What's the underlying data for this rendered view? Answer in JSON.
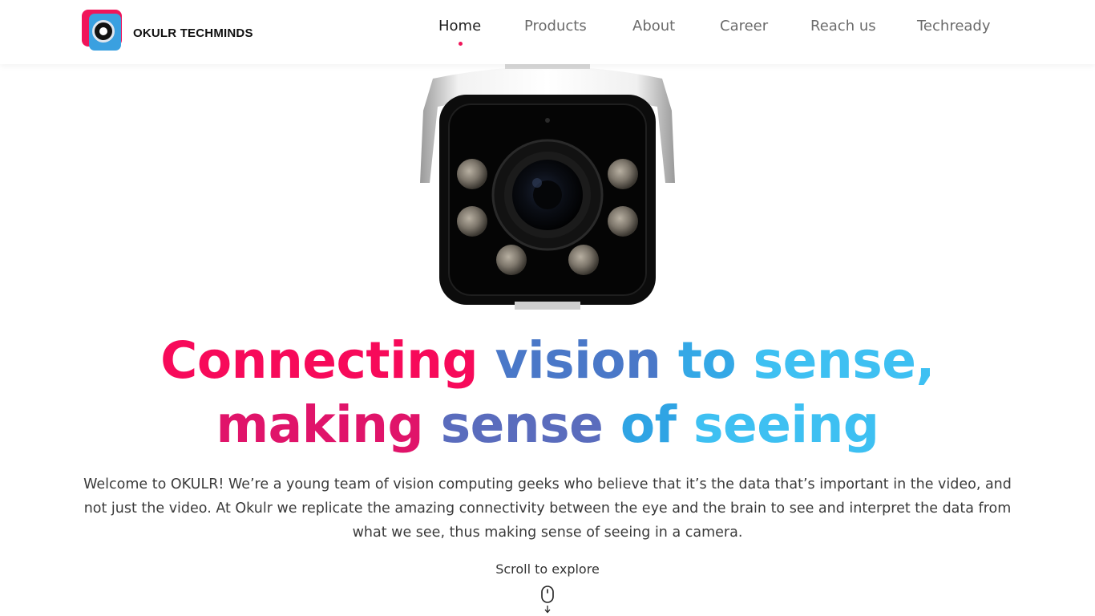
{
  "brand": {
    "name": "OKULR TECHMINDS",
    "logo_icon": "camera-lens-logo"
  },
  "nav": {
    "items": [
      {
        "label": "Home",
        "active": true
      },
      {
        "label": "Products",
        "active": false
      },
      {
        "label": "About",
        "active": false
      },
      {
        "label": "Career",
        "active": false
      },
      {
        "label": "Reach us",
        "active": false
      },
      {
        "label": "Techready",
        "active": false
      }
    ],
    "active_indicator_color": "#f0155a"
  },
  "hero": {
    "image_icon": "bullet-cctv-camera",
    "headline_line1": [
      "Connecting",
      "vision",
      "to",
      "sense,"
    ],
    "headline_line2": [
      "making",
      "sense",
      "of",
      "seeing"
    ],
    "gradient_colors": [
      "#f70a5a",
      "#9a4a9e",
      "#4a78c8",
      "#2fa4e4",
      "#3ec0f2"
    ],
    "intro": "Welcome to OKULR! We’re a young team of vision computing geeks who believe that it’s the data that’s important in the video, and not just the video. At Okulr we replicate the amazing connectivity between the eye and the brain to see and interpret the data from what we see, thus making sense of seeing in a camera.",
    "scroll_label": "Scroll to explore",
    "scroll_icon": "mouse-scroll-icon"
  }
}
